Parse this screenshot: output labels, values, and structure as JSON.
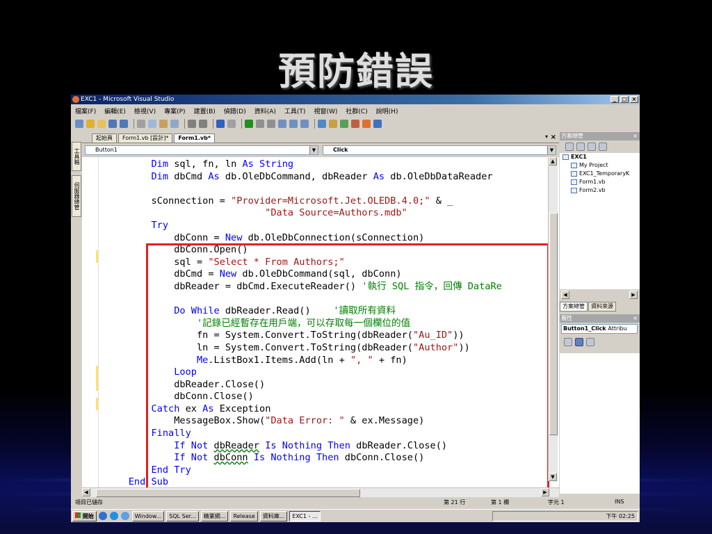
{
  "slide_title": "預防錯誤",
  "window": {
    "title": "EXC1 - Microsoft Visual Studio",
    "controls": [
      "_",
      "□",
      "×"
    ]
  },
  "menu": [
    "檔案(F)",
    "編輯(E)",
    "檢視(V)",
    "專案(P)",
    "建置(B)",
    "偵錯(D)",
    "資料(A)",
    "工具(T)",
    "視窗(W)",
    "社群(C)",
    "說明(H)"
  ],
  "side_tabs": [
    "工具箱",
    "伺服器總管"
  ],
  "document_tabs": {
    "items": [
      {
        "label": "起始頁",
        "active": false
      },
      {
        "label": "Form1.vb [設計]*",
        "active": false
      },
      {
        "label": "Form1.vb*",
        "active": true
      }
    ],
    "close": "×",
    "dropdown": "▾"
  },
  "dropdowns": {
    "object": "Button1",
    "event": "Click"
  },
  "code_lines": [
    [
      {
        "t": "        "
      },
      {
        "t": "Dim",
        "c": "kw"
      },
      {
        "t": " sql, fn, ln "
      },
      {
        "t": "As",
        "c": "kw"
      },
      {
        "t": " "
      },
      {
        "t": "String",
        "c": "kw"
      }
    ],
    [
      {
        "t": "        "
      },
      {
        "t": "Dim",
        "c": "kw"
      },
      {
        "t": " dbCmd "
      },
      {
        "t": "As",
        "c": "kw"
      },
      {
        "t": " db.OleDbCommand, dbReader "
      },
      {
        "t": "As",
        "c": "kw"
      },
      {
        "t": " db.OleDbDataReader"
      }
    ],
    [
      {
        "t": ""
      }
    ],
    [
      {
        "t": "        sConnection = "
      },
      {
        "t": "\"Provider=Microsoft.Jet.OLEDB.4.0;\"",
        "c": "st"
      },
      {
        "t": " & _"
      }
    ],
    [
      {
        "t": "                            "
      },
      {
        "t": "\"Data Source=Authors.mdb\"",
        "c": "st"
      }
    ],
    [
      {
        "t": "        "
      },
      {
        "t": "Try",
        "c": "kw"
      }
    ],
    [
      {
        "t": "            dbConn = "
      },
      {
        "t": "New",
        "c": "kw"
      },
      {
        "t": " db.OleDbConnection(sConnection)"
      }
    ],
    [
      {
        "t": "            dbConn.Open()"
      }
    ],
    [
      {
        "t": "            sql = "
      },
      {
        "t": "\"Select * From Authors;\"",
        "c": "st"
      }
    ],
    [
      {
        "t": "            dbCmd = "
      },
      {
        "t": "New",
        "c": "kw"
      },
      {
        "t": " db.OleDbCommand(sql, dbConn)"
      }
    ],
    [
      {
        "t": "            dbReader = dbCmd.ExecuteReader() "
      },
      {
        "t": "'執行 SQL 指令，回傳 DataRe",
        "c": "cm"
      }
    ],
    [
      {
        "t": ""
      }
    ],
    [
      {
        "t": "            "
      },
      {
        "t": "Do While",
        "c": "kw"
      },
      {
        "t": " dbReader.Read()    "
      },
      {
        "t": "'讀取所有資料",
        "c": "cm"
      }
    ],
    [
      {
        "t": "                "
      },
      {
        "t": "'記錄已經暫存在用戶端，可以存取每一個欄位的值",
        "c": "cm"
      }
    ],
    [
      {
        "t": "                fn = System.Convert.ToString(dbReader("
      },
      {
        "t": "\"Au_ID\"",
        "c": "st"
      },
      {
        "t": "))"
      }
    ],
    [
      {
        "t": "                ln = System.Convert.ToString(dbReader("
      },
      {
        "t": "\"Author\"",
        "c": "st"
      },
      {
        "t": "))"
      }
    ],
    [
      {
        "t": "                "
      },
      {
        "t": "Me",
        "c": "kw"
      },
      {
        "t": ".ListBox1.Items.Add(ln + "
      },
      {
        "t": "\", \"",
        "c": "st"
      },
      {
        "t": " + fn)"
      }
    ],
    [
      {
        "t": "            "
      },
      {
        "t": "Loop",
        "c": "kw"
      }
    ],
    [
      {
        "t": "            dbReader.Close()"
      }
    ],
    [
      {
        "t": "            dbConn.Close()"
      }
    ],
    [
      {
        "t": "        "
      },
      {
        "t": "Catch",
        "c": "kw"
      },
      {
        "t": " ex "
      },
      {
        "t": "As",
        "c": "kw"
      },
      {
        "t": " Exception"
      }
    ],
    [
      {
        "t": "            MessageBox.Show("
      },
      {
        "t": "\"Data Error: \"",
        "c": "st"
      },
      {
        "t": " & ex.Message)"
      }
    ],
    [
      {
        "t": "        "
      },
      {
        "t": "Finally",
        "c": "kw"
      }
    ],
    [
      {
        "t": "            "
      },
      {
        "t": "If Not",
        "c": "kw"
      },
      {
        "t": " "
      },
      {
        "t": "dbReader",
        "c": "sq"
      },
      {
        "t": " "
      },
      {
        "t": "Is Nothing Then",
        "c": "kw"
      },
      {
        "t": " dbReader.Close()"
      }
    ],
    [
      {
        "t": "            "
      },
      {
        "t": "If Not",
        "c": "kw"
      },
      {
        "t": " "
      },
      {
        "t": "dbConn",
        "c": "sq"
      },
      {
        "t": " "
      },
      {
        "t": "Is Nothing Then",
        "c": "kw"
      },
      {
        "t": " dbConn.Close()"
      }
    ],
    [
      {
        "t": "        "
      },
      {
        "t": "End Try",
        "c": "kw"
      }
    ],
    [
      {
        "t": "    "
      },
      {
        "t": "End Sub",
        "c": "kw"
      }
    ]
  ],
  "solution_explorer": {
    "title": "方案總管",
    "close": "×",
    "root": "EXC1",
    "items": [
      "My Project",
      "EXC1_TemporaryK",
      "Form1.vb",
      "Form2.vb"
    ],
    "tabs": [
      "方案總管",
      "資料來源"
    ]
  },
  "properties": {
    "title": "屬性",
    "close": "×",
    "object": "Button1_Click",
    "object_type": "Attribu"
  },
  "status": {
    "message": "項目已儲存",
    "line": "第 21 行",
    "col": "第 1 欄",
    "ch": "字元 1",
    "mode": "INS"
  },
  "taskbar": {
    "start": "開始",
    "tasks": [
      {
        "label": "Window...",
        "active": false
      },
      {
        "label": "SQL Ser...",
        "active": false
      },
      {
        "label": "精業網...",
        "active": false
      },
      {
        "label": "Release",
        "active": false
      },
      {
        "label": "資料庫...",
        "active": false
      },
      {
        "label": "EXC1 - ...",
        "active": true
      }
    ],
    "clock": "下午 02:25"
  },
  "colors": {
    "keyword": "#0000ff",
    "string": "#a31515",
    "comment": "#008000",
    "highlight_box": "#e02020"
  }
}
